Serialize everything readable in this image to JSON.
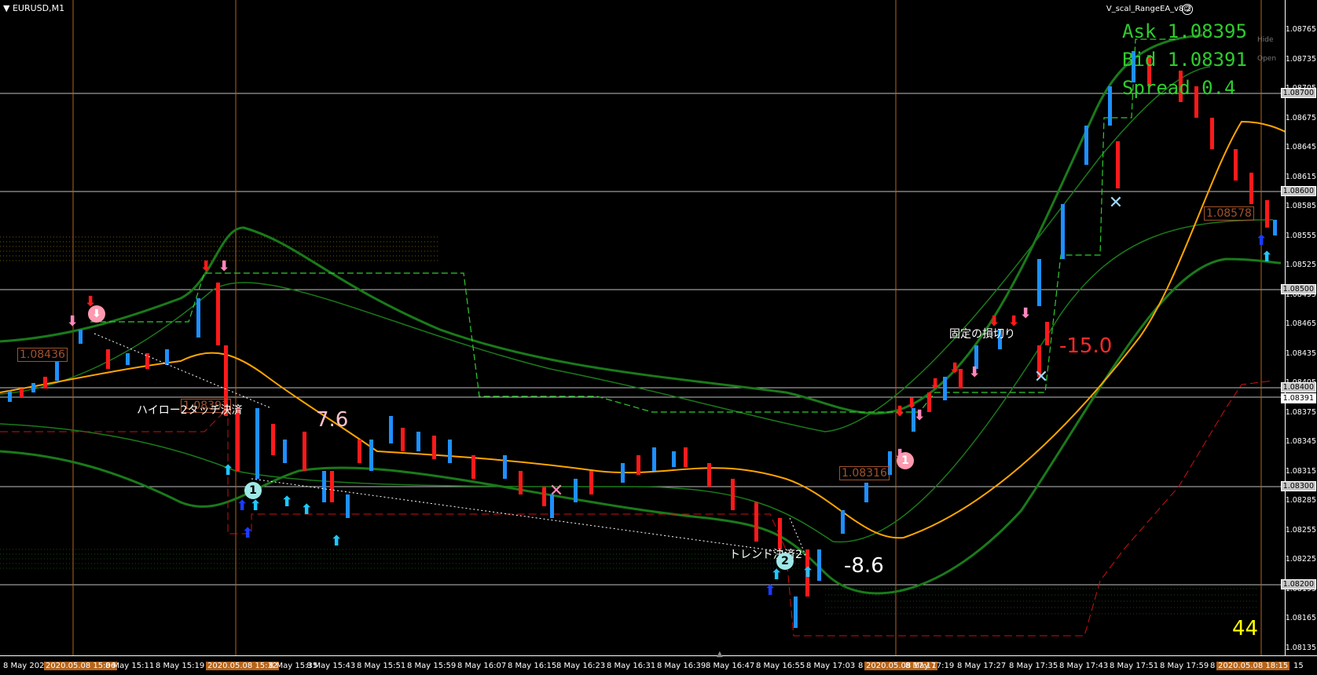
{
  "window": {
    "symbol_title": "EURUSD,M1",
    "ea_title": "V_scal_RangeEA_v8.2"
  },
  "info_panel": {
    "ask": "Ask 1.08395",
    "bid": "Bid 1.08391",
    "spread": "Spread 0.4",
    "side_labels": [
      "Hide",
      "Open"
    ]
  },
  "price_axis": {
    "ticks": [
      "1.08765",
      "1.08735",
      "1.08705",
      "1.08675",
      "1.08645",
      "1.08615",
      "1.08585",
      "1.08555",
      "1.08525",
      "1.08495",
      "1.08465",
      "1.08435",
      "1.08405",
      "1.08375",
      "1.08345",
      "1.08315",
      "1.08285",
      "1.08255",
      "1.08225",
      "1.08195",
      "1.08165",
      "1.08135"
    ],
    "tags": [
      "1.08700",
      "1.08600",
      "1.08500",
      "1.08400",
      "1.08391",
      "1.08300",
      "1.08200"
    ]
  },
  "time_axis": {
    "labels": [
      "8 May 2020",
      "8 May 15:11",
      "8 May 15:19",
      "8 May 15:35",
      "8 May 15:43",
      "8 May 15:51",
      "8 May 15:59",
      "8 May 16:07",
      "8 May 16:15",
      "8 May 16:23",
      "8 May 16:31",
      "8 May 16:39",
      "8 May 16:47",
      "8 May 16:55",
      "8 May 17:03",
      "8",
      "8 May 17:19",
      "8 May 17:27",
      "8 May 17:35",
      "8 May 17:43",
      "8 May 17:51",
      "8 May 17:59",
      "8",
      "15"
    ],
    "boxes": [
      "2020.05.08 15:06",
      "2020.05.08 15:32",
      "2020.05.08 17:17",
      "2020.05.08 18:15"
    ]
  },
  "chart_labels": {
    "left_price_box": "1.08436",
    "mid_price_box": "1.08391",
    "right_price_box_low": "1.08316",
    "right_price_box_high": "1.08578",
    "highlow_settle": "ハイロー2タッチ決済",
    "trend_settle": "トレンド決済2",
    "fixed_stop": "固定の損切り",
    "profit_1": "7.6",
    "profit_2": "-8.6",
    "profit_3": "-15.0",
    "counter": "44",
    "badge_1": "1",
    "badge_2": "2",
    "badge_3": "1"
  },
  "colors": {
    "background": "#000000",
    "bull": "#1e90ff",
    "bear": "#ff1a1a",
    "ma": "#ffa500",
    "band": "#1a7a1a",
    "info_text": "#2ecc2e",
    "counter": "#ffff00"
  }
}
